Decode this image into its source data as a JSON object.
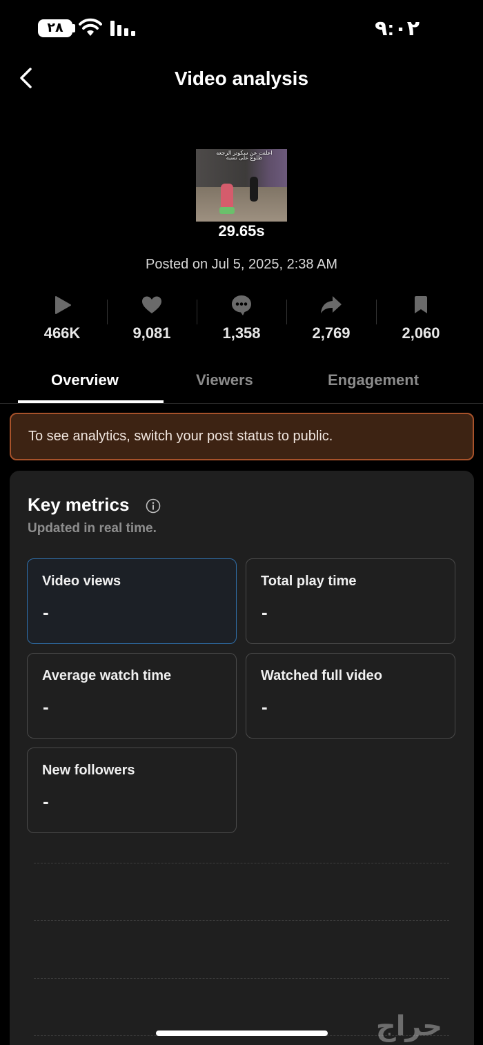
{
  "status_bar": {
    "battery": "٢٨",
    "time": "٩:٠٢"
  },
  "header": {
    "title": "Video analysis"
  },
  "video": {
    "thumbnail_caption": "اعلنت عن سكوتر الرجعه طلوع على نسبه",
    "duration": "29.65s",
    "posted": "Posted on Jul 5, 2025, 2:38 AM"
  },
  "stats": [
    {
      "icon": "play-icon",
      "value": "466K"
    },
    {
      "icon": "heart-icon",
      "value": "9,081"
    },
    {
      "icon": "comment-icon",
      "value": "1,358"
    },
    {
      "icon": "share-icon",
      "value": "2,769"
    },
    {
      "icon": "bookmark-icon",
      "value": "2,060"
    }
  ],
  "tabs": [
    {
      "label": "Overview",
      "active": true
    },
    {
      "label": "Viewers",
      "active": false
    },
    {
      "label": "Engagement",
      "active": false
    }
  ],
  "banner": {
    "text": "To see analytics, switch your post status to public."
  },
  "key_metrics": {
    "title": "Key metrics",
    "subtitle": "Updated in real time.",
    "metrics": [
      {
        "label": "Video views",
        "value": "-",
        "selected": true
      },
      {
        "label": "Total play time",
        "value": "-",
        "selected": false
      },
      {
        "label": "Average watch time",
        "value": "-",
        "selected": false
      },
      {
        "label": "Watched full video",
        "value": "-",
        "selected": false
      },
      {
        "label": "New followers",
        "value": "-",
        "selected": false
      }
    ]
  },
  "colors": {
    "background": "#000000",
    "card": "#1f1f1f",
    "banner_bg": "#3d2313",
    "banner_border": "#a8522a",
    "selected_border": "#2f6ea8",
    "inactive_tab": "#8b8b8b"
  },
  "watermark": "حراج"
}
